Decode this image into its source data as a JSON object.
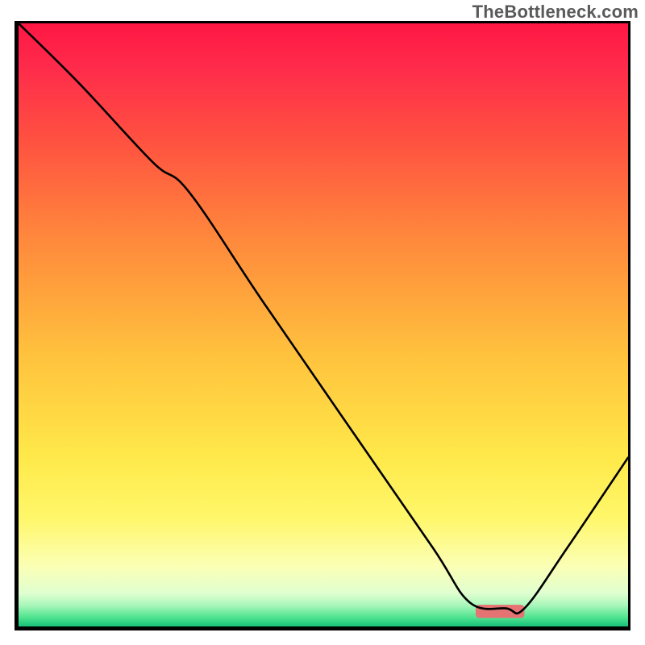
{
  "watermark": "TheBottleneck.com",
  "chart_data": {
    "type": "line",
    "title": "",
    "xlabel": "",
    "ylabel": "",
    "xlim": [
      0,
      100
    ],
    "ylim": [
      0,
      100
    ],
    "background_gradient": {
      "stops": [
        {
          "offset": 0.0,
          "color": "#ff1744"
        },
        {
          "offset": 0.07,
          "color": "#ff2a4b"
        },
        {
          "offset": 0.2,
          "color": "#ff5340"
        },
        {
          "offset": 0.35,
          "color": "#ff863c"
        },
        {
          "offset": 0.55,
          "color": "#ffc23d"
        },
        {
          "offset": 0.72,
          "color": "#ffe94a"
        },
        {
          "offset": 0.82,
          "color": "#fff76a"
        },
        {
          "offset": 0.9,
          "color": "#fbffb5"
        },
        {
          "offset": 0.945,
          "color": "#e0ffd0"
        },
        {
          "offset": 0.965,
          "color": "#a8f7bb"
        },
        {
          "offset": 0.985,
          "color": "#4fe38f"
        },
        {
          "offset": 1.0,
          "color": "#17c07a"
        }
      ]
    },
    "series": [
      {
        "name": "bottleneck-curve",
        "color": "#000000",
        "stroke_width": 2.6,
        "x": [
          0,
          10,
          22,
          28,
          40,
          55,
          68,
          74,
          80,
          83,
          90,
          100
        ],
        "y": [
          100,
          90,
          77,
          72,
          54,
          32,
          13,
          4,
          3,
          3,
          13,
          28
        ]
      }
    ],
    "annotations": [
      {
        "name": "optimal-marker",
        "type": "bar",
        "x_center": 79,
        "width": 8,
        "y": 2.5,
        "height": 2.2,
        "fill": "#e57373",
        "rx": 6
      }
    ]
  }
}
